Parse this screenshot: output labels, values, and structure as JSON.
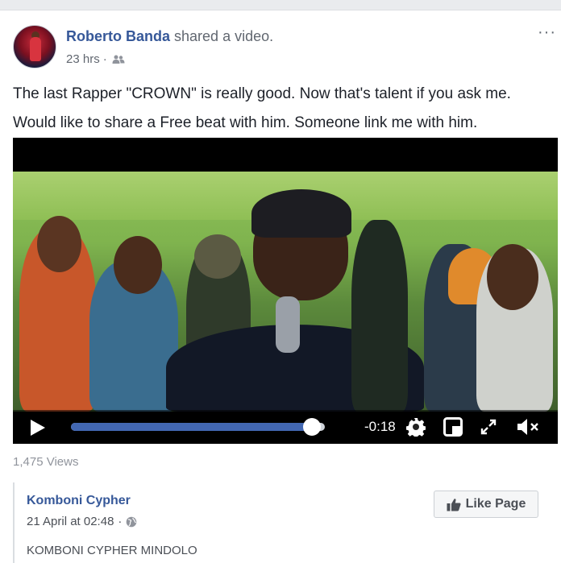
{
  "post": {
    "author": "Roberto Banda",
    "action": "shared a video.",
    "time": "23 hrs",
    "time_separator": "·",
    "audience_icon": "friends-icon",
    "more_icon": "more-options-icon",
    "text_line1": "The last Rapper \"CROWN\" is really good. Now that's talent if you ask me.",
    "text_line2": "Would like to share a Free beat with him. Someone link me with him."
  },
  "video": {
    "progress": 0.95,
    "time_remaining": "-0:18",
    "play_icon": "play-icon",
    "settings_icon": "gear-icon",
    "pip_icon": "picture-in-picture-icon",
    "fullscreen_icon": "fullscreen-icon",
    "mute_icon": "muted-speaker-icon",
    "accent_color": "#4267b2"
  },
  "views": "1,475 Views",
  "shared_page": {
    "name": "Komboni Cypher",
    "date": "21 April at 02:48",
    "separator": "·",
    "audience_icon": "globe-icon",
    "like_page_label": "Like Page",
    "description": "KOMBONI CYPHER MINDOLO"
  },
  "colors": {
    "link_blue": "#365899",
    "muted_text": "#616770",
    "background": "#e9ebee"
  }
}
